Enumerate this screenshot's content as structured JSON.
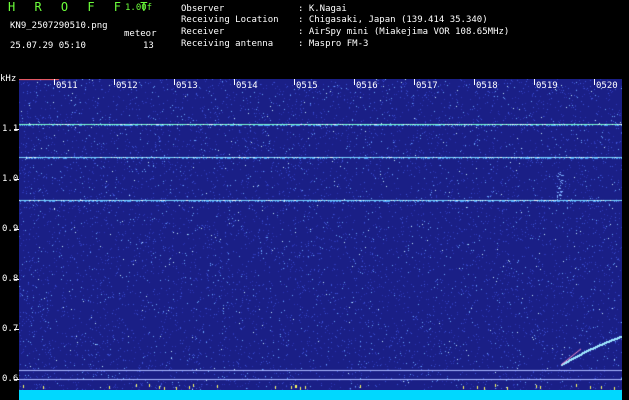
{
  "header": {
    "title": "H R O F F T",
    "version": "1.00f",
    "filename": "KN9_2507290510.png",
    "datetime": "25.07.29 05:10",
    "meteor_label": "meteor",
    "meteor_count": "13"
  },
  "info": [
    {
      "label": "Observer",
      "value": ": K.Nagai"
    },
    {
      "label": "Receiving Location",
      "value": ": Chigasaki, Japan (139.414 35.340)"
    },
    {
      "label": "Receiver",
      "value": ": AirSpy mini (Miakejima VOR 108.65MHz)"
    },
    {
      "label": "Receiving antenna",
      "value": ": Maspro FM-3"
    }
  ],
  "yaxis": {
    "unit": "kHz",
    "ticks": [
      "1.1",
      "1.0",
      "0.9",
      "0.8",
      "0.7",
      "0.6"
    ]
  },
  "xaxis": {
    "ticks": [
      "0511",
      "0512",
      "0513",
      "0514",
      "0515",
      "0516",
      "0517",
      "0518",
      "0519",
      "0520"
    ]
  },
  "colors": {
    "background": "#1a1f86",
    "carrier": "#7fd8ff",
    "accent": "#6cff3a",
    "baseline": "#00d8ff"
  }
}
